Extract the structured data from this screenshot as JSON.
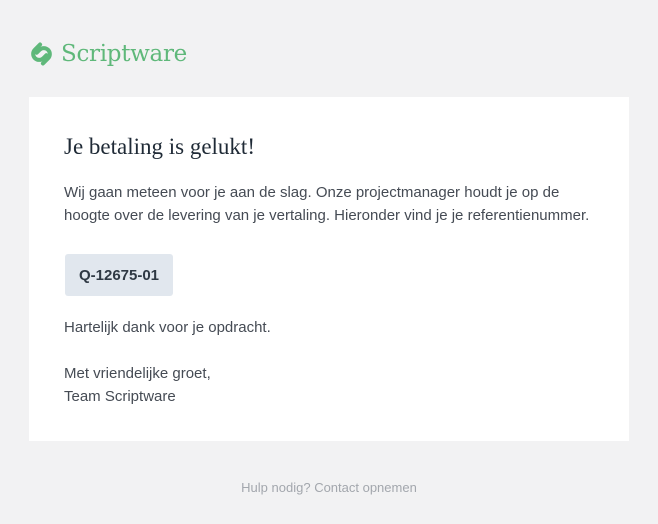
{
  "brand": {
    "name": "Scriptware",
    "logo_icon": "scriptware-logo-icon",
    "color": "#5fb87a"
  },
  "email": {
    "heading": "Je betaling is gelukt!",
    "intro": "Wij gaan meteen voor je aan de slag. Onze projectmanager houdt je op de hoogte over de levering van je vertaling. Hieronder vind je je referentienummer.",
    "reference_number": "Q-12675-01",
    "thanks": "Hartelijk dank voor je opdracht.",
    "closing_line1": "Met vriendelijke groet,",
    "closing_line2": "Team Scriptware"
  },
  "footer": {
    "help_question": "Hulp nodig?",
    "contact_link": "Contact opnemen"
  },
  "colors": {
    "page_background": "#f2f2f3",
    "card_background": "#ffffff",
    "reference_box": "#e1e7ee"
  }
}
